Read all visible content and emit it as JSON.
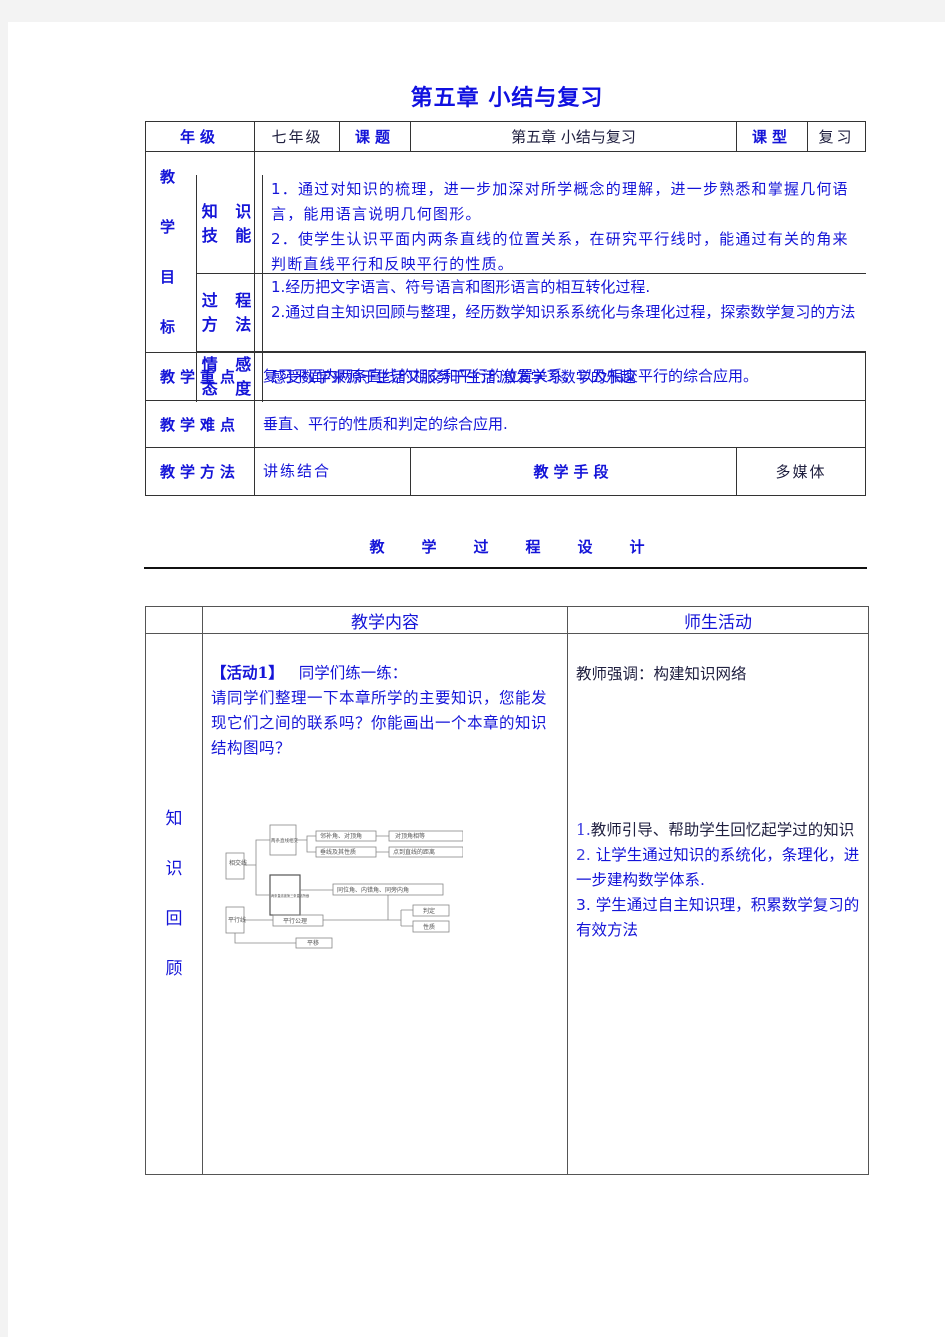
{
  "title": "第五章  小结与复习",
  "info_table": {
    "grade_label": "年级",
    "grade_value": "七年级",
    "topic_label": "课题",
    "topic_value": "第五章  小结与复习",
    "type_label": "课型",
    "type_value": "复习",
    "objectives_label": [
      "教",
      "学",
      "目",
      "标"
    ],
    "objectives": [
      {
        "label": "知识技能",
        "label_lines": [
          "知 识",
          "技 能"
        ],
        "lines": [
          "1．通过对知识的梳理，进一步加深对所学概念的理解，进一步熟悉和掌握几何语言，能用语言说明几何图形。",
          "2．使学生认识平面内两条直线的位置关系，在研究平行线时，能通过有关的角来判断直线平行和反映平行的性质。"
        ]
      },
      {
        "label": "过程方法",
        "label_lines": [
          "过 程",
          "方 法"
        ],
        "lines": [
          "1.经历把文字语言、符号语言和图形语言的相互转化过程.",
          "2.通过自主知识回顾与整理，经历数学知识系系统化与条理化过程，探索数学复习的方法"
        ]
      },
      {
        "label": "情感态度",
        "label_lines": [
          "情 感",
          "态 度"
        ],
        "lines": [
          "感受数学来源于生活又服务于生活.激发学习数学的乐趣"
        ]
      }
    ],
    "key_point_label": "教学重点",
    "key_point_value": "复习平面内两条直线的相交和平行的位置关系，以及相交平行的综合应用。",
    "difficulty_label": "教学难点",
    "difficulty_value": "垂直、平行的性质和判定的综合应用.",
    "method_label": "教学方法",
    "method_value": "讲练结合",
    "means_label": "教学手段",
    "means_value": "多媒体"
  },
  "process_title": [
    "教",
    "学",
    "过",
    "程",
    "设",
    "计"
  ],
  "process_table": {
    "col_content": "教学内容",
    "col_activity": "师生活动",
    "section_label": [
      "知",
      "识",
      "回",
      "顾"
    ],
    "activity_tag": "【活动1】",
    "activity_title": "同学们练一练：",
    "activity_text": "请同学们整理一下本章所学的主要知识，您能发现它们之间的联系吗？你能画出一个本章的知识结构图吗？",
    "diagram": {
      "nodes": {
        "intersect_lines": "相交线",
        "two_lines_intersect": "两条直线相交",
        "adjacent_vertical_angles": "邻补角、对顶角",
        "vertical_angles_equal": "对顶角相等",
        "perpendicular": "垂线及其性质",
        "point_line_distance": "点到直线的距离",
        "cut_by_third": "两条直线被第三条直线所截",
        "angles": "同位角、内错角、同旁内角",
        "parallel_lines": "平行线",
        "parallel_axiom": "平行公理",
        "criteria": "判定",
        "properties": "性质",
        "translation": "平移"
      }
    },
    "teacher_emphasis": "教师强调：构建知识网络",
    "activity_list": [
      {
        "num": "1.",
        "text": "教师引导、帮助学生回忆起学过的知识"
      },
      {
        "num": "2.",
        "text": " 让学生通过知识的系统化，条理化，进一步建构数学体系."
      },
      {
        "num": "3.",
        "text": " 学生通过自主知识理，积累数学复习的有效方法"
      }
    ]
  }
}
